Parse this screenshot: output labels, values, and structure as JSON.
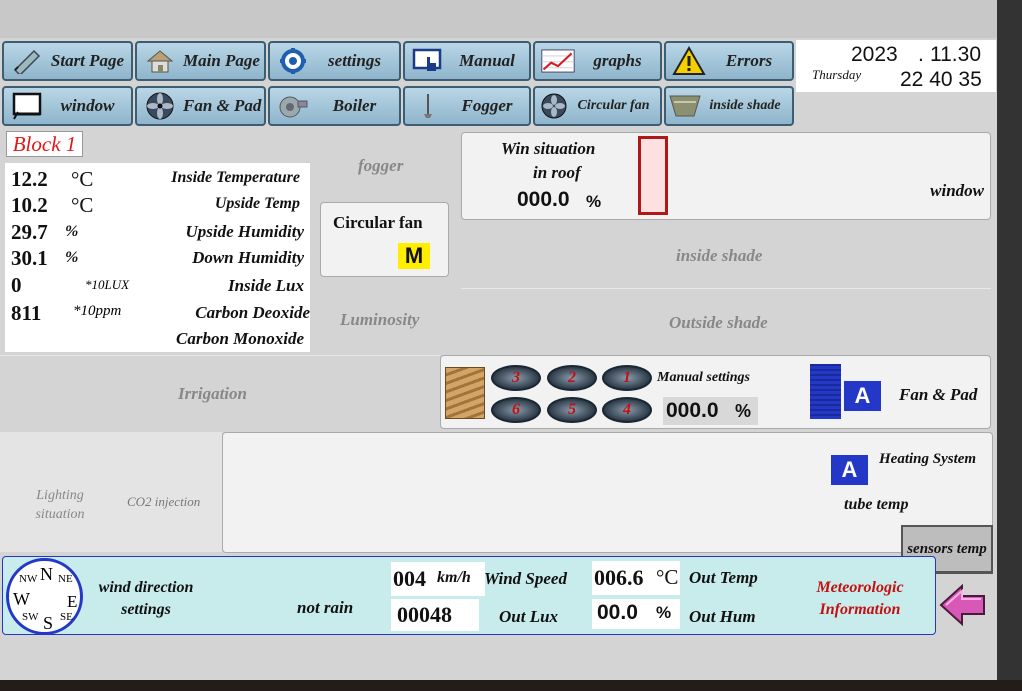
{
  "nav": {
    "row1": [
      {
        "label": "Start Page",
        "icon": "pencil-icon"
      },
      {
        "label": "Main Page",
        "icon": "home-icon"
      },
      {
        "label": "settings",
        "icon": "gear-icon"
      },
      {
        "label": "Manual",
        "icon": "hand-pointer-icon"
      },
      {
        "label": "graphs",
        "icon": "graph-icon"
      },
      {
        "label": "Errors",
        "icon": "warning-icon"
      }
    ],
    "row2": [
      {
        "label": "window",
        "icon": "window-icon"
      },
      {
        "label": "Fan & Pad",
        "icon": "fan-icon"
      },
      {
        "label": "Boiler",
        "icon": "boiler-icon"
      },
      {
        "label": "Fogger",
        "icon": "fogger-icon"
      },
      {
        "label": "Circular fan",
        "icon": "circular-fan-icon"
      },
      {
        "label": "inside shade",
        "icon": "shade-icon"
      }
    ]
  },
  "datetime": {
    "year": "2023",
    "month_day": "11.30",
    "weekday": "Thursday",
    "time": "22 40 35"
  },
  "block_title": "Block 1",
  "sensors": [
    {
      "value": "12.2",
      "unit": "°C",
      "label": "Inside Temperature"
    },
    {
      "value": "10.2",
      "unit": "°C",
      "label": "Upside Temp"
    },
    {
      "value": "29.7",
      "unit": "%",
      "label": "Upside Humidity"
    },
    {
      "value": "30.1",
      "unit": "%",
      "label": "Down Humidity"
    },
    {
      "value": "0",
      "unit": "*10LUX",
      "label": "Inside Lux"
    },
    {
      "value": "811",
      "unit": "*10ppm",
      "label": "Carbon Deoxide"
    },
    {
      "value": "",
      "unit": "",
      "label": "Carbon Monoxide"
    }
  ],
  "sections": {
    "fogger": "fogger",
    "luminosity": "Luminosity",
    "irrigation": "Irrigation",
    "lighting": "Lighting situation",
    "co2": "CO2 injection",
    "inside_shade": "inside shade",
    "outside_shade": "Outside shade"
  },
  "circular_fan": {
    "title": "Circular fan",
    "mode": "M"
  },
  "window": {
    "line1": "Win situation",
    "line2": "in roof",
    "value": "000.0",
    "unit": "%",
    "label": "window"
  },
  "fan_pad": {
    "fans_top": [
      "3",
      "2",
      "1"
    ],
    "fans_bottom": [
      "6",
      "5",
      "4"
    ],
    "manual_label": "Manual settings",
    "manual_value": "000.0",
    "manual_unit": "%",
    "mode": "A",
    "label": "Fan & Pad"
  },
  "heating": {
    "mode": "A",
    "label": "Heating System",
    "tube": "tube temp"
  },
  "sensors_temp_button": "sensors temp",
  "meteo": {
    "compass": {
      "n": "N",
      "s": "S",
      "e": "E",
      "w": "W",
      "nw": "NW",
      "ne": "NE",
      "sw": "SW",
      "se": "SE"
    },
    "wind_dir_label": "wind direction settings",
    "rain": "not rain",
    "wind_speed_value": "004",
    "wind_speed_unit": "km/h",
    "wind_speed_label": "Wind Speed",
    "out_lux_value": "00048",
    "out_lux_label": "Out Lux",
    "out_temp_value": "006.6",
    "out_temp_unit": "°C",
    "out_temp_label": "Out Temp",
    "out_hum_value": "00.0",
    "out_hum_unit": "%",
    "out_hum_label": "Out Hum",
    "title": "Meteorologic Information"
  },
  "colors": {
    "accent_blue": "#2438c8",
    "mode_yellow": "#ffee00",
    "meteo_bg": "#c8ecec",
    "alert_red": "#c41010",
    "back_arrow": "#d858b8"
  }
}
